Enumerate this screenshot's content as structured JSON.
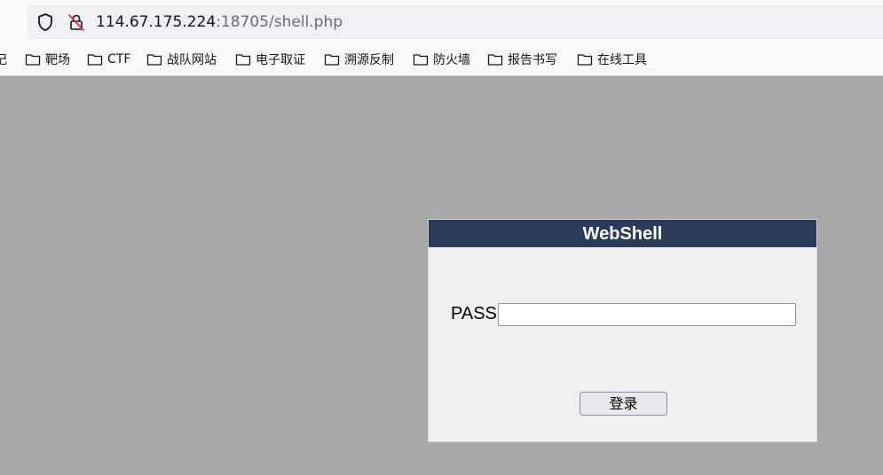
{
  "browser": {
    "url_host": "114.67.175.224",
    "url_rest": ":18705/shell.php",
    "bookmarks": [
      {
        "label": "记"
      },
      {
        "label": "靶场"
      },
      {
        "label": "CTF"
      },
      {
        "label": "战队网站"
      },
      {
        "label": "电子取证"
      },
      {
        "label": "溯源反制"
      },
      {
        "label": "防火墙"
      },
      {
        "label": "报告书写"
      },
      {
        "label": "在线工具"
      }
    ]
  },
  "login": {
    "title": "WebShell",
    "pass_label": "PASS:",
    "pass_value": "",
    "submit_label": "登录"
  },
  "colors": {
    "page_background": "#a8a8a8",
    "header_background": "#2a3c5a",
    "box_background": "#efefef"
  }
}
